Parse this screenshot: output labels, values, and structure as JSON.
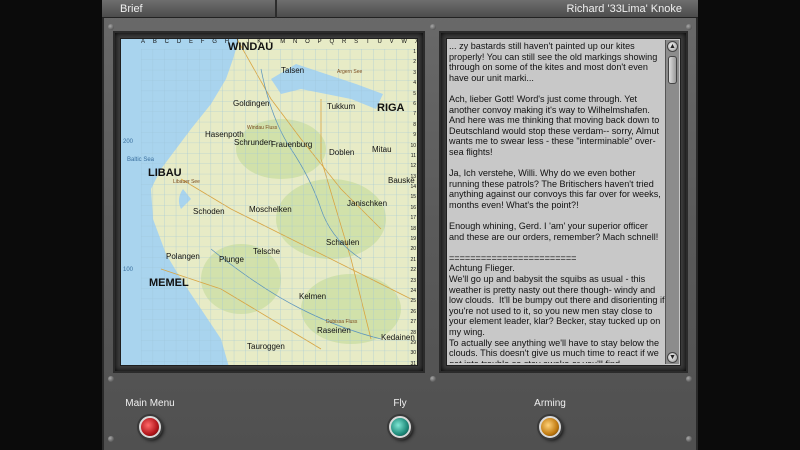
{
  "titlebar": {
    "left_title": "Brief",
    "right_title": "Richard '33Lima' Knoke"
  },
  "map": {
    "col_letters": [
      "A",
      "B",
      "C",
      "D",
      "E",
      "F",
      "G",
      "H",
      "I",
      "J",
      "K",
      "L",
      "M",
      "N",
      "O",
      "P",
      "Q",
      "R",
      "S",
      "T",
      "U",
      "V",
      "W",
      "X"
    ],
    "row_numbers": [
      "1",
      "2",
      "3",
      "4",
      "5",
      "6",
      "7",
      "8",
      "9",
      "10",
      "11",
      "12",
      "13",
      "14",
      "15",
      "16",
      "17",
      "18",
      "19",
      "20",
      "21",
      "22",
      "23",
      "24",
      "25",
      "26",
      "27",
      "28",
      "29",
      "30",
      "31"
    ],
    "labels": {
      "windau": "WINDAU",
      "talsen": "Talsen",
      "argern_see": "Argern See",
      "goldingen": "Goldingen",
      "tukkum": "Tukkum",
      "riga": "RIGA",
      "hasenpoth": "Hasenpoth",
      "windau_fluss": "Windau Fluss",
      "schrunden": "Schrunden",
      "frauenburg": "Frauenburg",
      "doblen": "Doblen",
      "mitau": "Mitau",
      "baltic_sea": "Baltic Sea",
      "libau": "LIBAU",
      "libau_see": "Libauer See",
      "bauske": "Bauske",
      "schoden": "Schoden",
      "moschelken": "Moschelken",
      "janischken": "Janischken",
      "telsche": "Telsche",
      "schaulen": "Schaulen",
      "polangen": "Polangen",
      "plunge": "Plunge",
      "memel": "MEMEL",
      "kelmen": "Kelmen",
      "raseinen": "Raseinen",
      "dubissa": "Dubissa Fluss",
      "kedainen": "Kedainen",
      "tauroggen": "Tauroggen",
      "scale_200": "200",
      "scale_100": "100"
    }
  },
  "brief": {
    "text": "... zy bastards still haven't painted up our kites properly! You can still see the old markings showing through on some of the kites and most don't even have our unit marki...\n\nAch, lieber Gott! Word's just come through. Yet another convoy making it's way to Wilhelmshafen. And here was me thinking that moving back down to Deutschland would stop these verdam-- sorry, Almut wants me to swear less - these \"interminable\" over-sea flights!\n\nJa, Ich verstehe, Willi. Why do we even bother running these patrols? The Britischers haven't tried anything against our convoys this far over for weeks, months even! What's the point?!\n\nEnough whining, Gerd. I 'am' your superior officer and these are our orders, remember? Mach schnell!\n\n========================\nAchtung Flieger.\nWe'll go up and babysit the squibs as usual - this weather is pretty nasty out there though- windy and low clouds.  It'll be bumpy out there and disorienting if you're not used to it, so you new men stay close to your element leader, klar? Becker, stay tucked up on my wing.\nTo actually see anything we'll have to stay below the clouds. This doesn't give us much time to react if we get into trouble so stay awake or you'll find"
  },
  "buttons": {
    "main_menu": "Main Menu",
    "fly": "Fly",
    "arming": "Arming"
  },
  "colors": {
    "main_menu_knob": "#b3161b",
    "fly_knob": "#1f8a7a",
    "arming_knob": "#c07a10"
  }
}
